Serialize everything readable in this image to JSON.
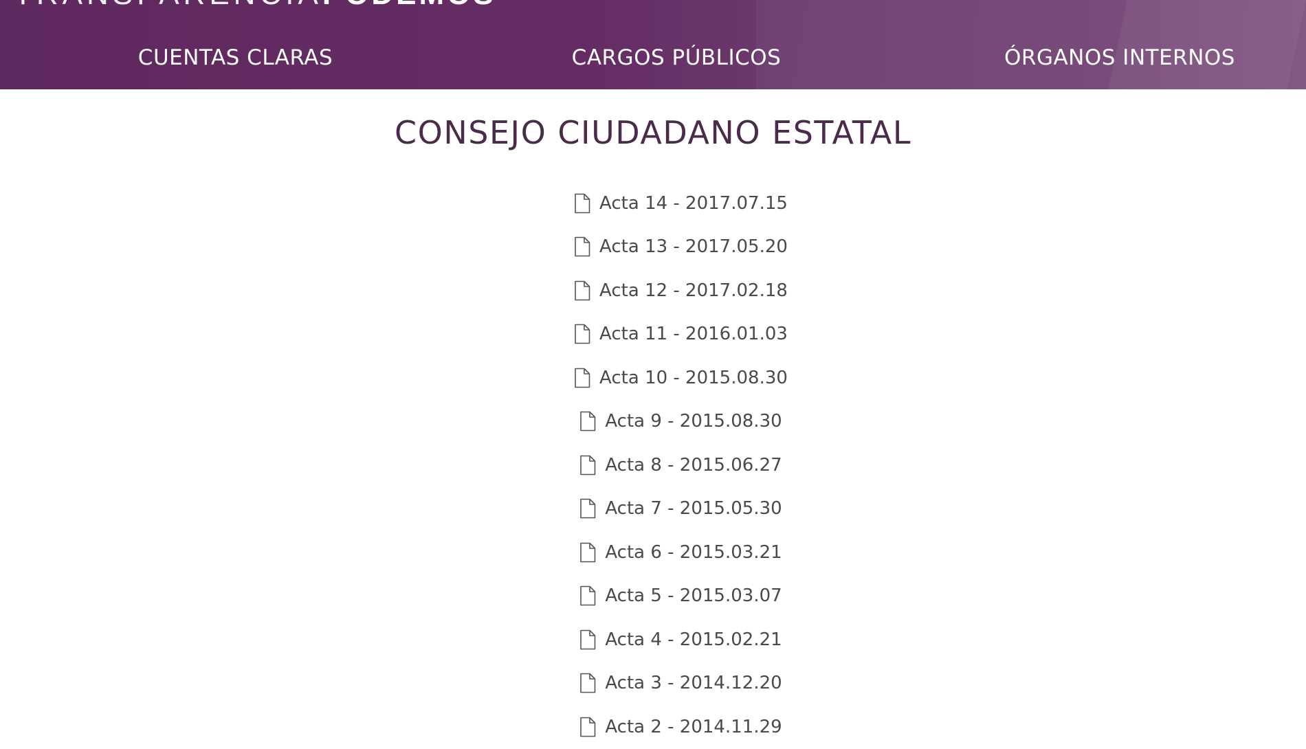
{
  "header": {
    "brand_light": "TRANSPARENCIA",
    "brand_bold": "PODEMOS",
    "nav": [
      {
        "label": "CUENTAS CLARAS"
      },
      {
        "label": "CARGOS PÚBLICOS"
      },
      {
        "label": "ÓRGANOS INTERNOS"
      }
    ],
    "colors": {
      "background": "#642c63",
      "text": "#ffffff"
    }
  },
  "main": {
    "title": "CONSEJO CIUDADANO ESTATAL",
    "documents": [
      {
        "label": "Acta 14 - 2017.07.15",
        "icon": "file-icon"
      },
      {
        "label": "Acta 13 - 2017.05.20",
        "icon": "file-icon"
      },
      {
        "label": "Acta 12 - 2017.02.18",
        "icon": "file-icon"
      },
      {
        "label": "Acta 11 - 2016.01.03",
        "icon": "file-icon"
      },
      {
        "label": "Acta 10 - 2015.08.30",
        "icon": "file-icon"
      },
      {
        "label": "Acta 9 - 2015.08.30",
        "icon": "file-icon"
      },
      {
        "label": "Acta 8 - 2015.06.27",
        "icon": "file-icon"
      },
      {
        "label": "Acta 7 - 2015.05.30",
        "icon": "file-icon"
      },
      {
        "label": "Acta 6 - 2015.03.21",
        "icon": "file-icon"
      },
      {
        "label": "Acta 5 - 2015.03.07",
        "icon": "file-icon"
      },
      {
        "label": "Acta 4 - 2015.02.21",
        "icon": "file-icon"
      },
      {
        "label": "Acta 3 - 2014.12.20",
        "icon": "file-icon"
      },
      {
        "label": "Acta 2 - 2014.11.29",
        "icon": "file-icon"
      }
    ],
    "colors": {
      "title": "#4a2c4a",
      "link": "#4a4a4a"
    }
  }
}
